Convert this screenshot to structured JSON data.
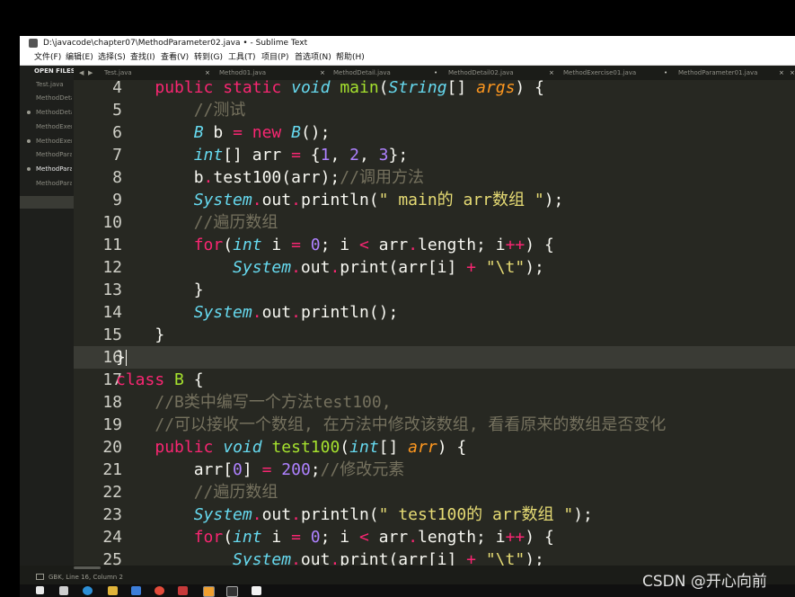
{
  "window": {
    "title": "D:\\javacode\\chapter07\\MethodParameter02.java • - Sublime Text"
  },
  "menu": [
    "文件(F)",
    "编辑(E)",
    "选择(S)",
    "查找(I)",
    "查看(V)",
    "转到(G)",
    "工具(T)",
    "项目(P)",
    "首选项(N)",
    "帮助(H)"
  ],
  "sidebar": {
    "header": "OPEN FILES",
    "items": [
      {
        "label": "Test.java",
        "dot": false,
        "active": false
      },
      {
        "label": "MethodDetail.java",
        "dot": false,
        "active": false
      },
      {
        "label": "MethodDetail02.java",
        "dot": true,
        "active": false
      },
      {
        "label": "MethodExercise01.java",
        "dot": false,
        "active": false
      },
      {
        "label": "MethodExercise02.java",
        "dot": true,
        "active": false
      },
      {
        "label": "MethodParameter01.java",
        "dot": false,
        "active": false
      },
      {
        "label": "MethodParameter02.java",
        "dot": true,
        "active": true
      },
      {
        "label": "MethodParameter03.java",
        "dot": false,
        "active": false
      }
    ]
  },
  "tabs": [
    {
      "label": "Test.java",
      "close": "×"
    },
    {
      "label": "Method01.java",
      "close": "×"
    },
    {
      "label": "MethodDetail.java",
      "close": "•"
    },
    {
      "label": "MethodDetail02.java",
      "close": "×"
    },
    {
      "label": "MethodExercise01.java",
      "close": "•"
    },
    {
      "label": "MethodParameter01.java",
      "close": "×"
    }
  ],
  "editor": {
    "lines": [
      {
        "n": "4",
        "html": "    <span class='kw'>public</span> <span class='kw'>static</span> <span class='ty'>void</span> <span class='fn'>main</span>(<span class='ty'>String</span>[] <span class='pa'>args</span>) {"
      },
      {
        "n": "5",
        "html": "        <span class='com'>//测试</span>"
      },
      {
        "n": "6",
        "html": "        <span class='ty'>B</span> b <span class='kw'>=</span> <span class='kw'>new</span> <span class='ty'>B</span>();"
      },
      {
        "n": "7",
        "html": "        <span class='ty'>int</span>[] arr <span class='kw'>=</span> {<span class='num'>1</span>, <span class='num'>2</span>, <span class='num'>3</span>};"
      },
      {
        "n": "8",
        "html": "        b<span class='kw'>.</span>test100(arr);<span class='com'>//调用方法</span>"
      },
      {
        "n": "9",
        "html": "        <span class='ty'>System</span><span class='kw'>.</span>out<span class='kw'>.</span>println(<span class='str'>\" main的 arr数组 \"</span>);"
      },
      {
        "n": "10",
        "html": "        <span class='com'>//遍历数组</span>"
      },
      {
        "n": "11",
        "html": "        <span class='kw'>for</span>(<span class='ty'>int</span> i <span class='kw'>=</span> <span class='num'>0</span>; i <span class='kw'>&lt;</span> arr<span class='kw'>.</span>length; i<span class='kw'>++</span>) {"
      },
      {
        "n": "12",
        "html": "            <span class='ty'>System</span><span class='kw'>.</span>out<span class='kw'>.</span>print(arr[i] <span class='kw'>+</span> <span class='str'>\"\\t\"</span>);"
      },
      {
        "n": "13",
        "html": "        }"
      },
      {
        "n": "14",
        "html": "        <span class='ty'>System</span><span class='kw'>.</span>out<span class='kw'>.</span>println();"
      },
      {
        "n": "15",
        "html": "    }"
      },
      {
        "n": "16",
        "html": "}<span class='cursor'></span>",
        "current": true
      },
      {
        "n": "17",
        "html": "<span class='kw'>class</span> <span class='cls'>B</span> {"
      },
      {
        "n": "18",
        "html": "    <span class='com'>//B类中编写一个方法test100,</span>"
      },
      {
        "n": "19",
        "html": "    <span class='com'>//可以接收一个数组, 在方法中修改该数组, 看看原来的数组是否变化</span>"
      },
      {
        "n": "20",
        "html": "    <span class='kw'>public</span> <span class='ty'>void</span> <span class='fn'>test100</span>(<span class='ty'>int</span>[] <span class='pa'>arr</span>) {"
      },
      {
        "n": "21",
        "html": "        arr[<span class='num'>0</span>] <span class='kw'>=</span> <span class='num'>200</span>;<span class='com'>//修改元素</span>"
      },
      {
        "n": "22",
        "html": "        <span class='com'>//遍历数组</span>"
      },
      {
        "n": "23",
        "html": "        <span class='ty'>System</span><span class='kw'>.</span>out<span class='kw'>.</span>println(<span class='str'>\" test100的 arr数组 \"</span>);"
      },
      {
        "n": "24",
        "html": "        <span class='kw'>for</span>(<span class='ty'>int</span> i <span class='kw'>=</span> <span class='num'>0</span>; i <span class='kw'>&lt;</span> arr<span class='kw'>.</span>length; i<span class='kw'>++</span>) {"
      },
      {
        "n": "25",
        "html": "            <span class='ty'>System</span><span class='kw'>.</span>out<span class='kw'>.</span>print(arr[i] <span class='kw'>+</span> <span class='str'>\"\\t\"</span>);"
      }
    ]
  },
  "status": {
    "text": "GBK, Line 16, Column 2"
  },
  "watermark": "CSDN @开心向前",
  "colors": {
    "background": "#272822",
    "keyword": "#f92672",
    "type": "#66d9ef",
    "function": "#a6e22e",
    "string": "#e6db74",
    "number": "#ae81ff",
    "comment": "#75715e"
  }
}
